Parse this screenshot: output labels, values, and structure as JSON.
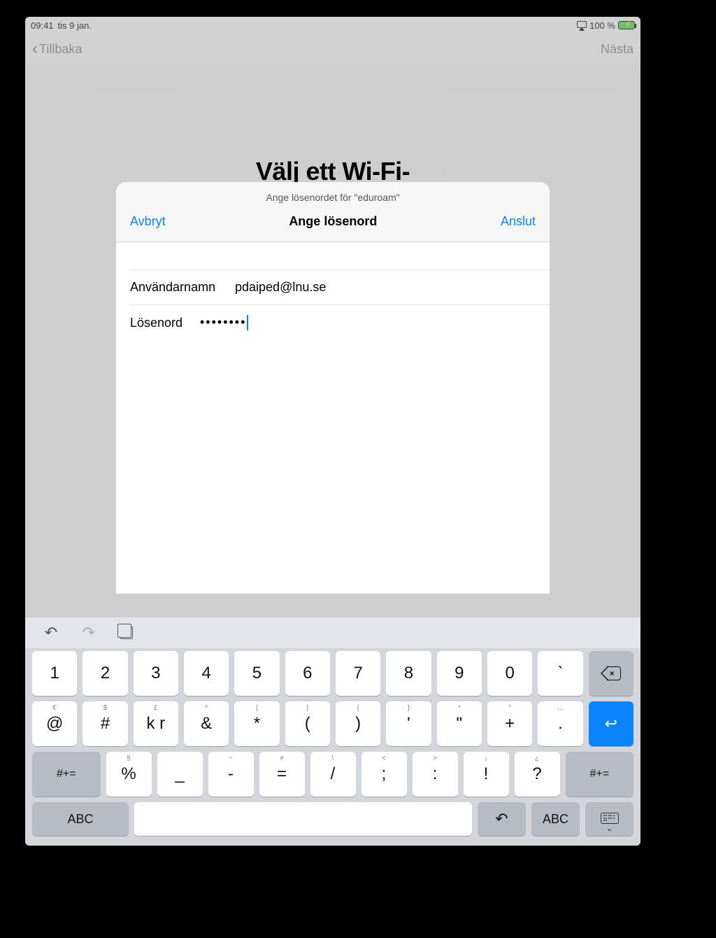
{
  "status": {
    "time": "09:41",
    "date": "tis 9 jan.",
    "battery": "100 %"
  },
  "nav": {
    "back": "Tillbaka",
    "next": "Nästa"
  },
  "page": {
    "title": "Välj ett Wi-Fi-"
  },
  "sheet": {
    "subtitle": "Ange lösenordet för \"eduroam\"",
    "cancel": "Avbryt",
    "title": "Ange lösenord",
    "join": "Anslut",
    "username_label": "Användarnamn",
    "username_value": "pdaiped@lnu.se",
    "password_label": "Lösenord",
    "password_masked": "••••••••"
  },
  "keyboard": {
    "row1": [
      "1",
      "2",
      "3",
      "4",
      "5",
      "6",
      "7",
      "8",
      "9",
      "0",
      "`"
    ],
    "row2": [
      {
        "main": "@",
        "alt": "€"
      },
      {
        "main": "#",
        "alt": "$"
      },
      {
        "main": "k r",
        "alt": "£"
      },
      {
        "main": "&",
        "alt": "^"
      },
      {
        "main": "*",
        "alt": "["
      },
      {
        "main": "(",
        "alt": "]"
      },
      {
        "main": ")",
        "alt": "{"
      },
      {
        "main": "'",
        "alt": "}"
      },
      {
        "main": "\"",
        "alt": "*"
      },
      {
        "main": "+",
        "alt": "°"
      },
      {
        "main": ".",
        "alt": "…"
      }
    ],
    "row3": [
      {
        "main": "%",
        "alt": "§"
      },
      {
        "main": "_",
        "alt": ""
      },
      {
        "main": "-",
        "alt": "~"
      },
      {
        "main": "=",
        "alt": "≠"
      },
      {
        "main": "/",
        "alt": "\\"
      },
      {
        "main": ";",
        "alt": "<"
      },
      {
        "main": ":",
        "alt": ">"
      },
      {
        "main": "!",
        "alt": "¡"
      },
      {
        "main": "?",
        "alt": "¿"
      }
    ],
    "sym_left": "#+=",
    "sym_right": "#+=",
    "abc": "ABC"
  }
}
